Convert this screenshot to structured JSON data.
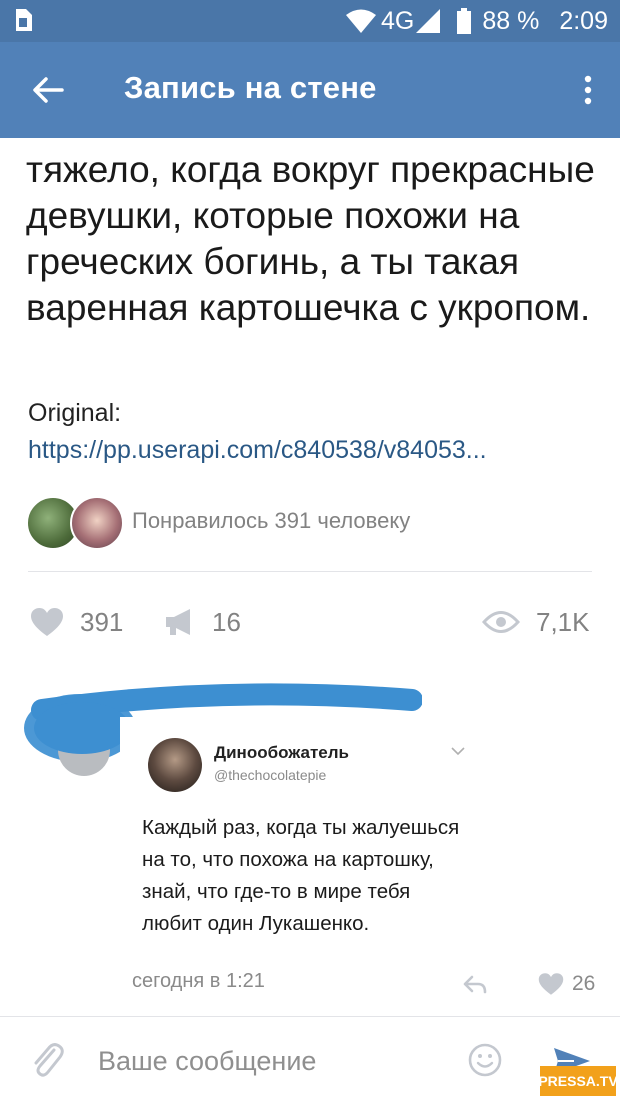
{
  "status_bar": {
    "network": "4G",
    "battery": "88 %",
    "time": "2:09"
  },
  "app_bar": {
    "title": "Запись на стене"
  },
  "post": {
    "text": "тяжело, когда вокруг прекрасные девушки, которые похожи на греческих богинь, а ты такая варенная картошечка с укропом.",
    "original_label": "Original:",
    "original_link": "https://pp.userapi.com/c840538/v84053..."
  },
  "likes_summary": {
    "text": "Понравилось 391 человеку"
  },
  "stats": {
    "likes": "391",
    "reposts": "16",
    "views": "7,1K"
  },
  "comment": {
    "tweet": {
      "name": "Динообожатель",
      "handle": "@thechocolatepie",
      "text": "Каждый раз, когда ты жалуешься на то, что похожа на картошку, знай, что где-то в мире тебя любит один Лукашенко."
    },
    "time": "сегодня в 1:21",
    "likes": "26"
  },
  "composer": {
    "placeholder": "Ваше сообщение"
  },
  "watermark": {
    "text": "PRESSA.TV"
  },
  "colors": {
    "status_bar": "#4a76a8",
    "app_bar": "#5181b8",
    "link": "#2a5885",
    "scribble": "#3d8fd1",
    "watermark": "#f2a11b"
  }
}
